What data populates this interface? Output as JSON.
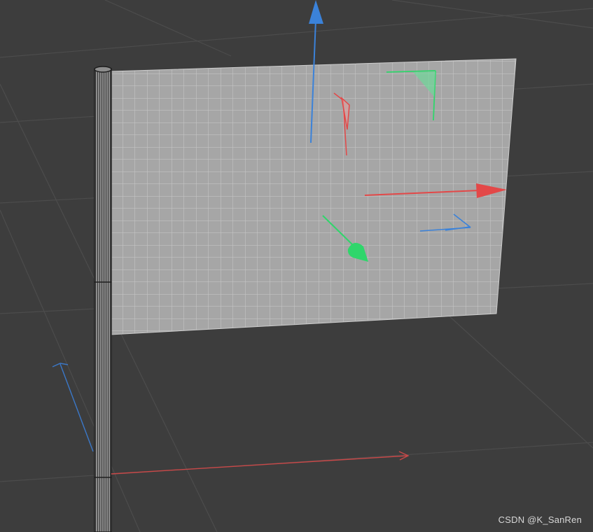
{
  "viewport": {
    "background_color": "#3d3d3d",
    "grid_line_color": "#4e4e4e"
  },
  "scene": {
    "flag_color": "#a8a8a8",
    "flag_wire_color": "#c8c8c8",
    "pole_color": "#8f8f8f",
    "pole_wire_color": "#1e1e1e"
  },
  "gizmo": {
    "x_axis_color": "#e34848",
    "y_axis_color": "#2fd66b",
    "z_axis_color": "#3b82d9",
    "icons": [
      "move-x-arrow",
      "move-y-arrow",
      "move-z-arrow",
      "rotate-handle",
      "scale-handle"
    ]
  },
  "watermark": {
    "text": "CSDN @K_SanRen"
  }
}
